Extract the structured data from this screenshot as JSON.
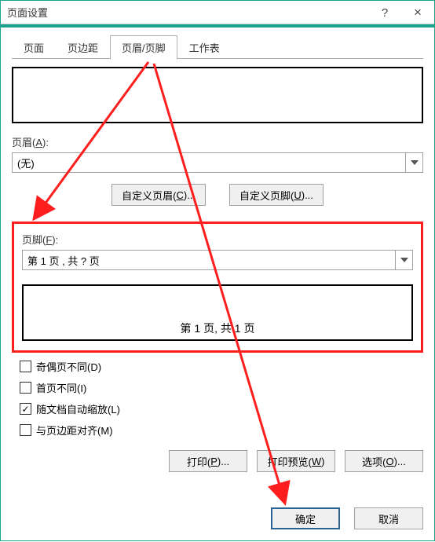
{
  "window": {
    "title": "页面设置",
    "help_icon": "?",
    "close_icon": "×"
  },
  "tabs": [
    {
      "label": "页面"
    },
    {
      "label": "页边距"
    },
    {
      "label": "页眉/页脚"
    },
    {
      "label": "工作表"
    }
  ],
  "active_tab_index": 2,
  "header": {
    "label_prefix": "页眉(",
    "label_key": "A",
    "label_suffix": "):",
    "value": "(无)",
    "custom_header_btn_prefix": "自定义页眉(",
    "custom_header_btn_key": "C",
    "custom_header_btn_suffix": ")...",
    "custom_footer_btn_prefix": "自定义页脚(",
    "custom_footer_btn_key": "U",
    "custom_footer_btn_suffix": ")..."
  },
  "footer": {
    "label_prefix": "页脚(",
    "label_key": "F",
    "label_suffix": "):",
    "value": "第 1 页 ,  共 ? 页",
    "preview_text": "第  1  页,  共  1  页"
  },
  "checkboxes": {
    "odd_even_prefix": "奇偶页不同(",
    "odd_even_key": "D",
    "odd_even_suffix": ")",
    "first_page_prefix": "首页不同(",
    "first_page_key": "I",
    "first_page_suffix": ")",
    "scale_doc_prefix": "随文档自动缩放(",
    "scale_doc_key": "L",
    "scale_doc_suffix": ")",
    "scale_doc_checked": true,
    "align_margin_prefix": "与页边距对齐(",
    "align_margin_key": "M",
    "align_margin_suffix": ")"
  },
  "bottom_buttons": {
    "print_prefix": "打印(",
    "print_key": "P",
    "print_suffix": ")...",
    "preview_prefix": "打印预览(",
    "preview_key": "W",
    "preview_suffix": ")",
    "options_prefix": "选项(",
    "options_key": "O",
    "options_suffix": ")..."
  },
  "actions": {
    "ok": "确定",
    "cancel": "取消"
  }
}
